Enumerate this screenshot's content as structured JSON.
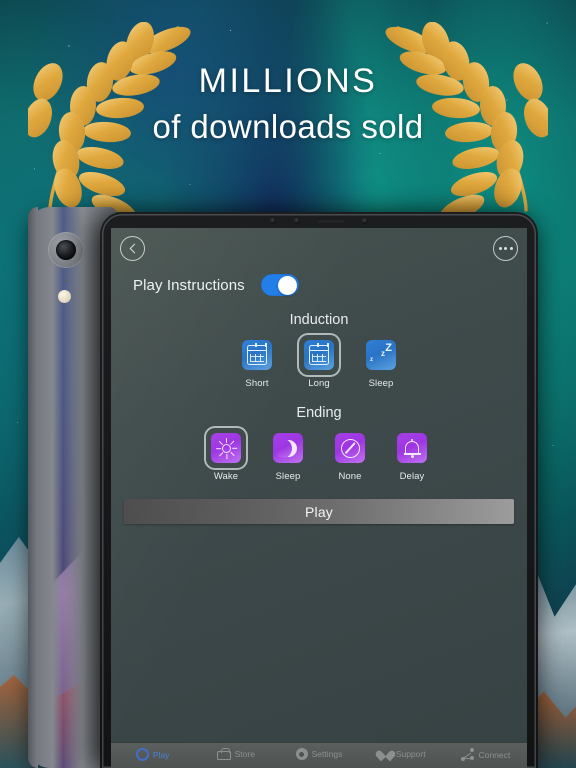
{
  "hero": {
    "title": "MILLIONS",
    "subtitle": "of downloads sold",
    "laurel_left_icon": "laurel-wreath-icon",
    "laurel_right_icon": "laurel-wreath-icon",
    "gold": "#e0a93f",
    "text_color": "#ffffff"
  },
  "app": {
    "topbar": {
      "back_icon": "chevron-left-icon",
      "more_icon": "ellipsis-icon"
    },
    "play_instructions": {
      "label": "Play Instructions",
      "toggle_on": true,
      "toggle_color": "#1f7ce8"
    },
    "induction": {
      "title": "Induction",
      "accent": "#2e7fd6",
      "options": [
        {
          "label": "Short",
          "icon": "calendar-icon",
          "selected": false
        },
        {
          "label": "Long",
          "icon": "calendar-icon",
          "selected": true
        },
        {
          "label": "Sleep",
          "icon": "zzz-icon",
          "selected": false
        }
      ]
    },
    "ending": {
      "title": "Ending",
      "accent": "#a73fe8",
      "options": [
        {
          "label": "Wake",
          "icon": "sun-icon",
          "selected": true
        },
        {
          "label": "Sleep",
          "icon": "moon-icon",
          "selected": false
        },
        {
          "label": "None",
          "icon": "no-entry-circle-icon",
          "selected": false
        },
        {
          "label": "Delay",
          "icon": "bell-icon",
          "selected": false
        }
      ]
    },
    "play_button": {
      "label": "Play"
    },
    "tabbar": {
      "active_color": "#4a7fd6",
      "tabs": [
        {
          "label": "Play",
          "icon": "play-circle-icon",
          "active": true
        },
        {
          "label": "Store",
          "icon": "bag-icon",
          "active": false
        },
        {
          "label": "Settings",
          "icon": "gear-icon",
          "active": false
        },
        {
          "label": "Support",
          "icon": "heart-icon",
          "active": false
        },
        {
          "label": "Connect",
          "icon": "share-nodes-icon",
          "active": false
        }
      ]
    }
  },
  "devices": {
    "back_device": {
      "camera_icon": "camera-lens-icon",
      "flash_icon": "flash-icon"
    }
  }
}
